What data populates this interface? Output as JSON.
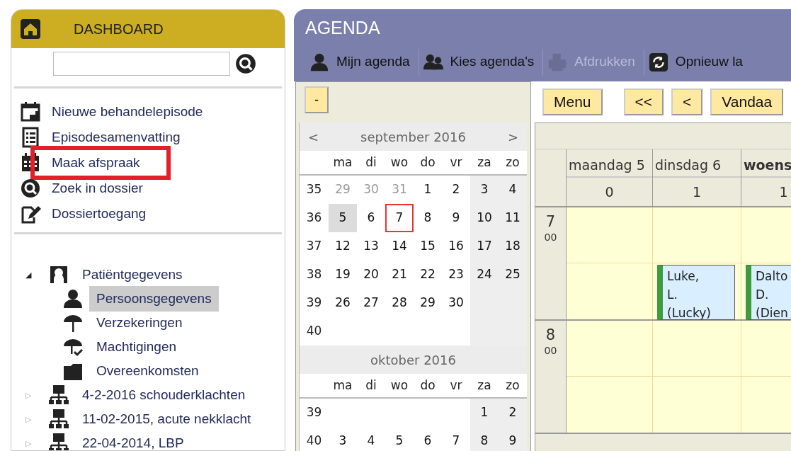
{
  "dashboard": {
    "title": "DASHBOARD",
    "menu": [
      {
        "kind": "calendar-plus",
        "label": "Nieuwe behandelepisode",
        "highlighted": false
      },
      {
        "kind": "list",
        "label": "Episodesamenvatting",
        "highlighted": false
      },
      {
        "kind": "calendar",
        "label": "Maak afspraak",
        "highlighted": true
      },
      {
        "kind": "search",
        "label": "Zoek in dossier",
        "highlighted": false
      },
      {
        "kind": "edit",
        "label": "Dossiertoegang",
        "highlighted": false
      }
    ],
    "tree": [
      {
        "kind": "patient",
        "toggle": "◢",
        "label": "Patiëntgegevens",
        "expanded": true,
        "selected": false,
        "children": [
          {
            "kind": "person",
            "label": "Persoonsgegevens",
            "selected": true
          },
          {
            "kind": "umbrella",
            "label": "Verzekeringen",
            "selected": false
          },
          {
            "kind": "umbrella-check",
            "label": "Machtigingen",
            "selected": false
          },
          {
            "kind": "folder",
            "label": "Overeenkomsten",
            "selected": false
          }
        ]
      },
      {
        "kind": "network",
        "toggle": "▷",
        "label": "4-2-2016 schouderklachten",
        "expanded": false,
        "selected": false
      },
      {
        "kind": "network",
        "toggle": "▷",
        "label": "11-02-2015, acute nekklacht",
        "expanded": false,
        "selected": false
      },
      {
        "kind": "network",
        "toggle": "▷",
        "label": "22-04-2014, LBP",
        "expanded": false,
        "selected": false
      }
    ]
  },
  "agenda": {
    "title": "AGENDA",
    "toolbar": [
      {
        "kind": "person",
        "label": "Mijn agenda",
        "disabled": false
      },
      {
        "kind": "people",
        "label": "Kies agenda's",
        "disabled": false
      },
      {
        "kind": "printer",
        "label": "Afdrukken",
        "disabled": true
      },
      {
        "kind": "refresh",
        "label": "Opnieuw la",
        "disabled": false
      }
    ],
    "collapse_button": "-",
    "nav_buttons": [
      "Menu",
      "<<",
      "<",
      "Vandaa"
    ],
    "mini_calendars": [
      {
        "title": "september 2016",
        "prev": "<",
        "next": ">",
        "weekdays": [
          "ma",
          "di",
          "wo",
          "do",
          "vr",
          "za",
          "zo"
        ],
        "weeks": [
          {
            "number": "35",
            "days": [
              {
                "text": "29",
                "kind": "other"
              },
              {
                "text": "30",
                "kind": "other"
              },
              {
                "text": "31",
                "kind": "other"
              },
              {
                "text": "1",
                "kind": "day"
              },
              {
                "text": "2",
                "kind": "day"
              },
              {
                "text": "3",
                "kind": "day"
              },
              {
                "text": "4",
                "kind": "day"
              }
            ]
          },
          {
            "number": "36",
            "days": [
              {
                "text": "5",
                "kind": "day",
                "selected": true
              },
              {
                "text": "6",
                "kind": "day"
              },
              {
                "text": "7",
                "kind": "day",
                "today": true
              },
              {
                "text": "8",
                "kind": "day"
              },
              {
                "text": "9",
                "kind": "day"
              },
              {
                "text": "10",
                "kind": "day"
              },
              {
                "text": "11",
                "kind": "day"
              }
            ]
          },
          {
            "number": "37",
            "days": [
              {
                "text": "12",
                "kind": "day"
              },
              {
                "text": "13",
                "kind": "day"
              },
              {
                "text": "14",
                "kind": "day"
              },
              {
                "text": "15",
                "kind": "day"
              },
              {
                "text": "16",
                "kind": "day"
              },
              {
                "text": "17",
                "kind": "day"
              },
              {
                "text": "18",
                "kind": "day"
              }
            ]
          },
          {
            "number": "38",
            "days": [
              {
                "text": "19",
                "kind": "day"
              },
              {
                "text": "20",
                "kind": "day"
              },
              {
                "text": "21",
                "kind": "day"
              },
              {
                "text": "22",
                "kind": "day"
              },
              {
                "text": "23",
                "kind": "day"
              },
              {
                "text": "24",
                "kind": "day"
              },
              {
                "text": "25",
                "kind": "day"
              }
            ]
          },
          {
            "number": "39",
            "days": [
              {
                "text": "26",
                "kind": "day"
              },
              {
                "text": "27",
                "kind": "day"
              },
              {
                "text": "28",
                "kind": "day"
              },
              {
                "text": "29",
                "kind": "day"
              },
              {
                "text": "30",
                "kind": "day"
              },
              {
                "kind": "empty"
              },
              {
                "kind": "empty"
              }
            ]
          },
          {
            "number": "40",
            "days": [
              {
                "kind": "empty"
              },
              {
                "kind": "empty"
              },
              {
                "kind": "empty"
              },
              {
                "kind": "empty"
              },
              {
                "kind": "empty"
              },
              {
                "kind": "empty"
              },
              {
                "kind": "empty"
              }
            ]
          }
        ]
      },
      {
        "title": "oktober 2016",
        "weekdays": [
          "ma",
          "di",
          "wo",
          "do",
          "vr",
          "za",
          "zo"
        ],
        "weeks": [
          {
            "number": "39",
            "days": [
              {
                "kind": "empty"
              },
              {
                "kind": "empty"
              },
              {
                "kind": "empty"
              },
              {
                "kind": "empty"
              },
              {
                "kind": "empty"
              },
              {
                "text": "1",
                "kind": "day"
              },
              {
                "text": "2",
                "kind": "day"
              }
            ]
          },
          {
            "number": "40",
            "days": [
              {
                "text": "3",
                "kind": "day"
              },
              {
                "text": "4",
                "kind": "day"
              },
              {
                "text": "5",
                "kind": "day"
              },
              {
                "text": "6",
                "kind": "day"
              },
              {
                "text": "7",
                "kind": "day"
              },
              {
                "text": "8",
                "kind": "day"
              },
              {
                "text": "9",
                "kind": "day"
              }
            ]
          }
        ]
      }
    ],
    "week": {
      "days": [
        {
          "label": "maandag 5",
          "count": "0",
          "bold": false
        },
        {
          "label": "dinsdag 6",
          "count": "1",
          "bold": false
        },
        {
          "label": "woens",
          "count": "1",
          "bold": true
        }
      ],
      "hours": [
        {
          "hour": "7",
          "minutes": "00",
          "slots": [
            {
              "cells": [
                {},
                {},
                {}
              ]
            },
            {
              "cells": [
                {},
                {
                  "appointment": "Luke, L. (Lucky)"
                },
                {
                  "appointment": "Dalto D. (Dien"
                }
              ]
            }
          ]
        },
        {
          "hour": "8",
          "minutes": "00",
          "slots": [
            {
              "cells": [
                {},
                {},
                {}
              ]
            },
            {
              "cells": [
                {},
                {},
                {}
              ]
            }
          ]
        }
      ]
    }
  }
}
